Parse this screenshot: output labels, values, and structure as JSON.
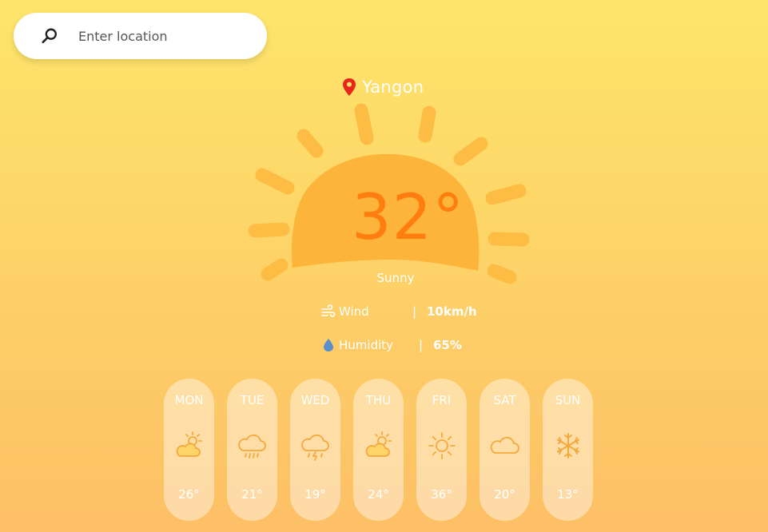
{
  "search": {
    "placeholder": "Enter location",
    "icon": "search-icon"
  },
  "location": {
    "icon": "map-pin-icon",
    "city": "Yangon"
  },
  "current": {
    "temperature": "32°",
    "condition": "Sunny",
    "icon": "sun-icon"
  },
  "stats": {
    "wind": {
      "icon": "wind-icon",
      "label": "Wind",
      "separator": "|",
      "value": "10km/h"
    },
    "humidity": {
      "icon": "droplet-icon",
      "label": "Humidity",
      "separator": "|",
      "value": "65%"
    }
  },
  "forecast": [
    {
      "day": "MON",
      "icon": "partly-sunny-icon",
      "temp": "26°"
    },
    {
      "day": "TUE",
      "icon": "rain-cloud-icon",
      "temp": "21°"
    },
    {
      "day": "WED",
      "icon": "thunderstorm-icon",
      "temp": "19°"
    },
    {
      "day": "THU",
      "icon": "partly-sunny-icon",
      "temp": "24°"
    },
    {
      "day": "FRI",
      "icon": "sun-icon",
      "temp": "36°"
    },
    {
      "day": "SAT",
      "icon": "cloud-icon",
      "temp": "20°"
    },
    {
      "day": "SUN",
      "icon": "snowflake-icon",
      "temp": "13°"
    }
  ],
  "colors": {
    "background_top": "#fde56b",
    "background_bottom": "#fdbf66",
    "temperature": "#ff7e0f",
    "sun_body": "#fdb43a",
    "pin": "#e8261b",
    "forecast_icon": "#f4a93d"
  }
}
